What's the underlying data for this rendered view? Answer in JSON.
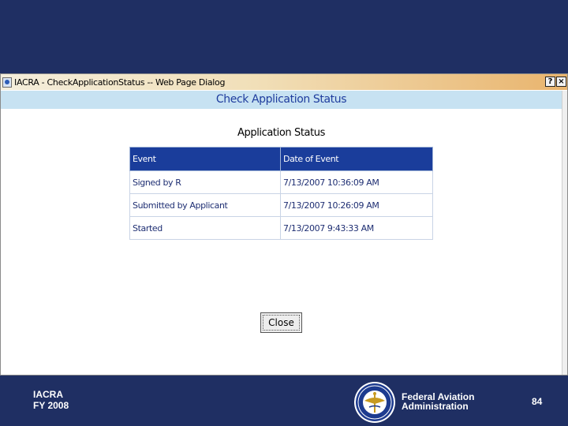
{
  "window": {
    "title": "IACRA - CheckApplicationStatus -- Web Page Dialog",
    "help_label": "?",
    "close_label": "×"
  },
  "page": {
    "header": "Check Application Status",
    "section_title": "Application Status"
  },
  "table": {
    "columns": [
      "Event",
      "Date of Event"
    ],
    "rows": [
      [
        "Signed by R",
        "7/13/2007 10:36:09 AM"
      ],
      [
        "Submitted by Applicant",
        "7/13/2007 10:26:09 AM"
      ],
      [
        "Started",
        "7/13/2007 9:43:33 AM"
      ]
    ]
  },
  "buttons": {
    "close_label": "Close"
  },
  "footer": {
    "left_line1": "IACRA",
    "left_line2": "FY 2008",
    "agency_line1": "Federal Aviation",
    "agency_line2": "Administration",
    "page_number": "84",
    "seal_icon": "faa-seal-icon"
  },
  "colors": {
    "slide_background": "#1f2f63",
    "table_header": "#1a3d9b",
    "header_band": "#c7e2f2",
    "header_text": "#1f3d9e"
  }
}
